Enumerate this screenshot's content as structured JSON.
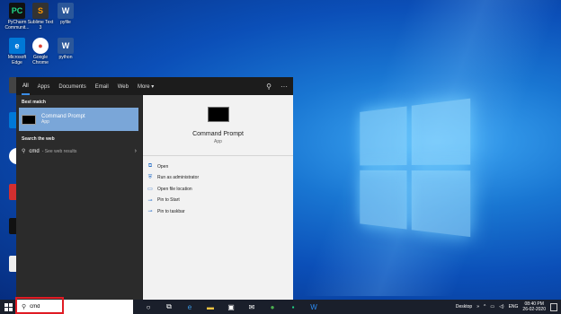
{
  "desktop": {
    "icons": [
      {
        "label": "PyCharm Communit...",
        "abbr": "PC",
        "color": "#21d789"
      },
      {
        "label": "Sublime Text 3",
        "abbr": "S",
        "color": "#ff9800"
      },
      {
        "label": "pyfile",
        "abbr": "W",
        "color": "#2b579a"
      },
      {
        "label": "Microsoft Edge",
        "abbr": "e",
        "color": "#0078d7"
      },
      {
        "label": "Google Chrome",
        "abbr": "●",
        "color": "#db4437"
      },
      {
        "label": "python",
        "abbr": "W",
        "color": "#2b579a"
      }
    ]
  },
  "start_menu": {
    "tabs": [
      "All",
      "Apps",
      "Documents",
      "Email",
      "Web",
      "More ▾"
    ],
    "best_match_heading": "Best match",
    "best_match": {
      "title": "Command Prompt",
      "subtitle": "App"
    },
    "search_web_heading": "Search the web",
    "web_result": {
      "query": "cmd",
      "hint": "- See web results"
    },
    "preview": {
      "title": "Command Prompt",
      "subtitle": "App",
      "actions": [
        {
          "label": "Open",
          "icon": "open-icon"
        },
        {
          "label": "Run as administrator",
          "icon": "shield-icon"
        },
        {
          "label": "Open file location",
          "icon": "folder-icon"
        },
        {
          "label": "Pin to Start",
          "icon": "pin-icon"
        },
        {
          "label": "Pin to taskbar",
          "icon": "pin-icon"
        }
      ]
    }
  },
  "taskbar": {
    "search_value": "cmd",
    "desktop_label": "Desktop",
    "language": "ENG",
    "time": "08:40 PM",
    "date": "26-02-2020"
  }
}
